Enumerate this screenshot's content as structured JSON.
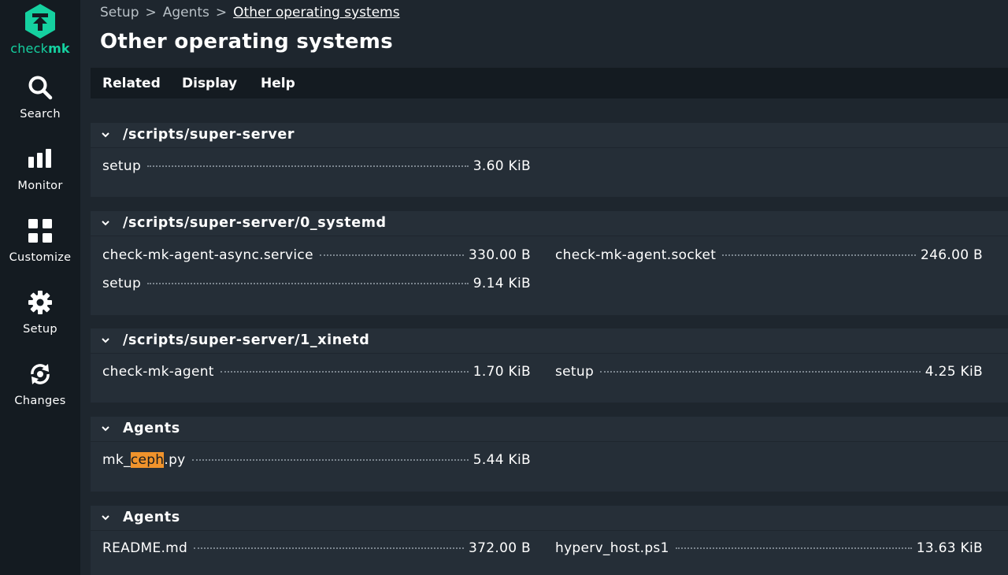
{
  "sidebar": {
    "logo_text_light": "check",
    "logo_text_bold": "mk",
    "items": [
      {
        "label": "Search",
        "icon": "search-icon"
      },
      {
        "label": "Monitor",
        "icon": "monitor-icon"
      },
      {
        "label": "Customize",
        "icon": "customize-icon"
      },
      {
        "label": "Setup",
        "icon": "setup-gear-icon"
      },
      {
        "label": "Changes",
        "icon": "changes-icon"
      }
    ]
  },
  "breadcrumb": {
    "items": [
      "Setup",
      "Agents",
      "Other operating systems"
    ],
    "separator": ">"
  },
  "page_title": "Other operating systems",
  "menu": [
    "Related",
    "Display",
    "Help"
  ],
  "sections": [
    {
      "title": "/scripts/super-server",
      "files": [
        {
          "name": "setup",
          "size": "3.60 KiB"
        }
      ]
    },
    {
      "title": "/scripts/super-server/0_systemd",
      "files": [
        {
          "name": "check-mk-agent-async.service",
          "size": "330.00 B"
        },
        {
          "name": "check-mk-agent.socket",
          "size": "246.00 B"
        },
        {
          "name": "setup",
          "size": "9.14 KiB"
        }
      ]
    },
    {
      "title": "/scripts/super-server/1_xinetd",
      "files": [
        {
          "name": "check-mk-agent",
          "size": "1.70 KiB"
        },
        {
          "name": "setup",
          "size": "4.25 KiB"
        }
      ]
    },
    {
      "title": "Agents",
      "files": [
        {
          "name_prefix": "mk_",
          "name_highlight": "ceph",
          "name_suffix": ".py",
          "size": "5.44 KiB"
        }
      ]
    },
    {
      "title": "Agents",
      "files": [
        {
          "name": "README.md",
          "size": "372.00 B"
        },
        {
          "name": "hyperv_host.ps1",
          "size": "13.63 KiB"
        }
      ]
    }
  ],
  "colors": {
    "background": "#1e262e",
    "sidebar": "#141b21",
    "section": "#252e37",
    "brand": "#15d1a0",
    "highlight": "#f0932c"
  }
}
